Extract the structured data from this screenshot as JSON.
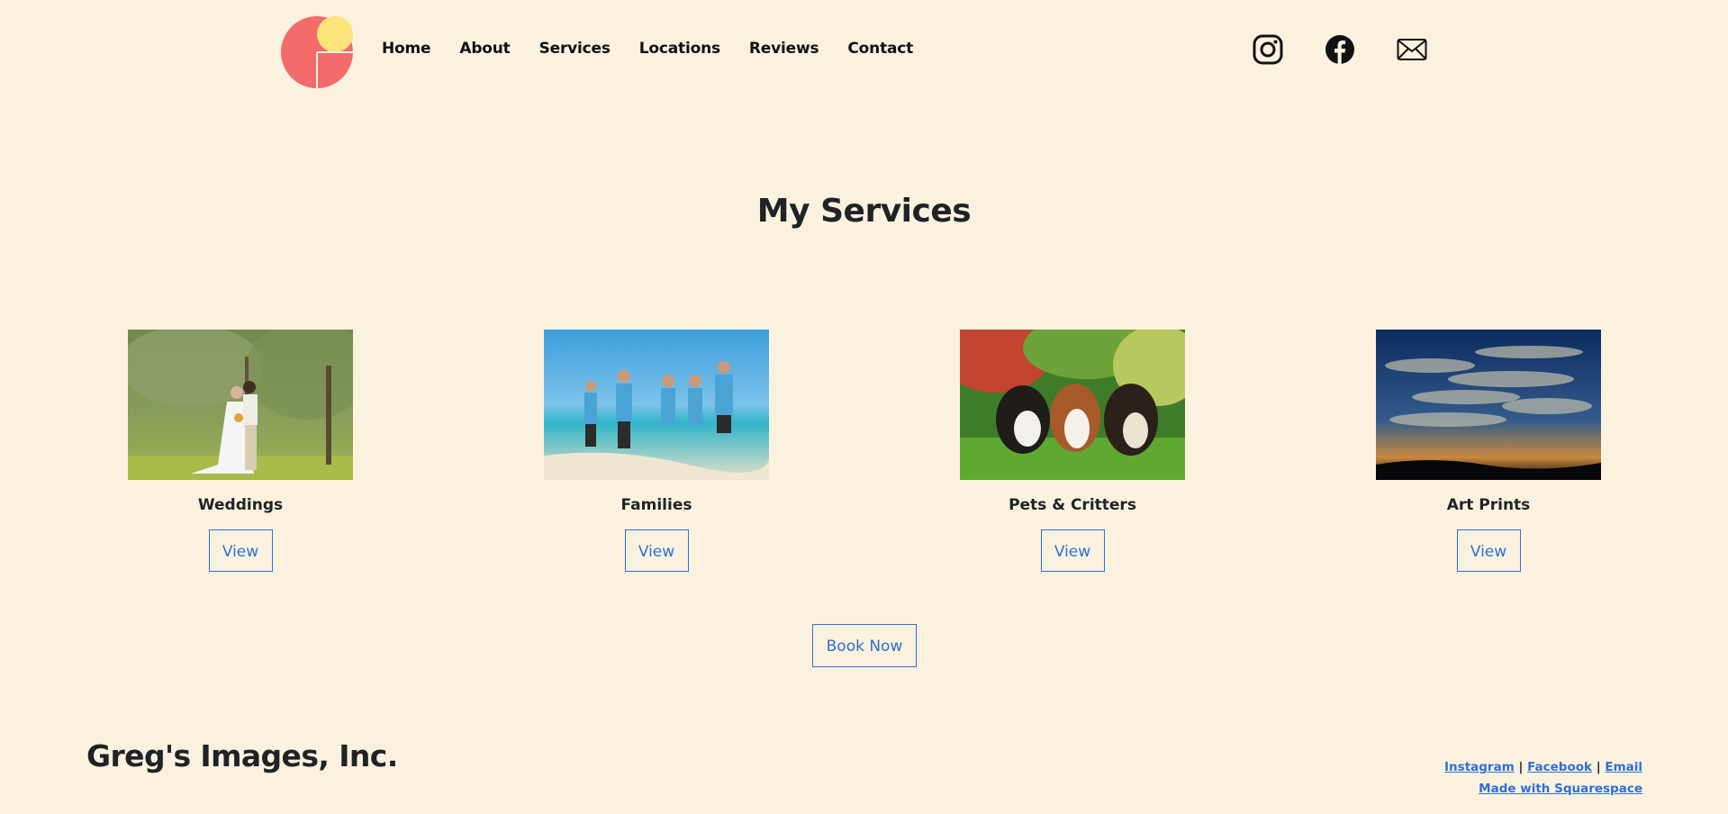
{
  "nav": {
    "items": [
      {
        "label": "Home"
      },
      {
        "label": "About"
      },
      {
        "label": "Services"
      },
      {
        "label": "Locations"
      },
      {
        "label": "Reviews"
      },
      {
        "label": "Contact"
      }
    ]
  },
  "social": {
    "icons": [
      "instagram-icon",
      "facebook-icon",
      "email-icon"
    ]
  },
  "main": {
    "title": "My Services",
    "services": [
      {
        "label": "Weddings",
        "button": "View",
        "photo": "wedding-photo"
      },
      {
        "label": "Families",
        "button": "View",
        "photo": "family-beach-photo"
      },
      {
        "label": "Pets & Critters",
        "button": "View",
        "photo": "dogs-photo"
      },
      {
        "label": "Art Prints",
        "button": "View",
        "photo": "sky-clouds-photo"
      }
    ],
    "book_now": "Book Now"
  },
  "footer": {
    "brand": "Greg's Images, Inc.",
    "links": [
      "Instagram",
      "Facebook",
      "Email"
    ],
    "separator": "|",
    "made_with": "Made with Squarespace"
  },
  "colors": {
    "background": "#faf2df",
    "accent": "#2f6fd6",
    "logo_red": "#f36b6b",
    "logo_yellow": "#fde47a"
  }
}
